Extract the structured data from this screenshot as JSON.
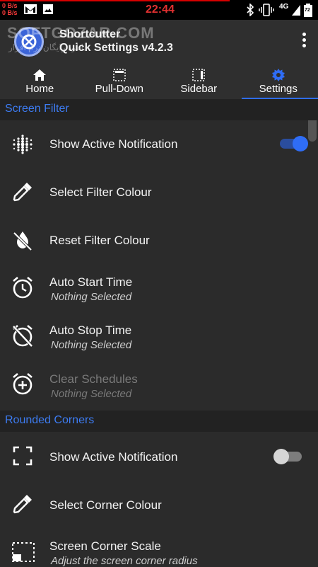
{
  "status_bar": {
    "net_up": "0 B/s",
    "net_down": "0 B/s",
    "time": "22:44",
    "network_label": "4G",
    "battery_level": "72",
    "icons": [
      "mail-icon",
      "image-icon",
      "bluetooth-icon",
      "vibrate-icon",
      "signal-icon",
      "battery-icon"
    ]
  },
  "app_bar": {
    "title_line1": "Shortcutter",
    "title_line2": "Quick Settings v4.2.3",
    "watermark": "SOFTGOZAR.COM",
    "watermark_sub": "دانلود رایگان نرم افزار",
    "menu_icon": "more-vert-icon"
  },
  "tabs": [
    {
      "label": "Home",
      "icon": "home-icon",
      "active": false
    },
    {
      "label": "Pull-Down",
      "icon": "pulldown-grid-icon",
      "active": false
    },
    {
      "label": "Sidebar",
      "icon": "sidebar-grid-icon",
      "active": false
    },
    {
      "label": "Settings",
      "icon": "gear-icon",
      "active": true
    }
  ],
  "sections": {
    "screen_filter": {
      "header": "Screen Filter",
      "rows": [
        {
          "title": "Show Active Notification",
          "subtitle": "",
          "icon": "dots-grid-icon",
          "toggle": "on"
        },
        {
          "title": "Select Filter Colour",
          "subtitle": "",
          "icon": "eyedropper-icon"
        },
        {
          "title": "Reset Filter Colour",
          "subtitle": "",
          "icon": "invert-colors-off-icon"
        },
        {
          "title": "Auto Start Time",
          "subtitle": "Nothing Selected",
          "icon": "alarm-icon"
        },
        {
          "title": "Auto Stop Time",
          "subtitle": "Nothing Selected",
          "icon": "alarm-off-icon"
        },
        {
          "title": "Clear Schedules",
          "subtitle": "Nothing Selected",
          "icon": "alarm-add-icon",
          "disabled": true
        }
      ]
    },
    "rounded_corners": {
      "header": "Rounded Corners",
      "rows": [
        {
          "title": "Show Active Notification",
          "subtitle": "",
          "icon": "fullscreen-corners-icon",
          "toggle": "off"
        },
        {
          "title": "Select Corner Colour",
          "subtitle": "",
          "icon": "eyedropper-icon"
        },
        {
          "title": "Screen Corner Scale",
          "subtitle": "Adjust the screen corner radius",
          "icon": "corner-scale-icon"
        }
      ]
    }
  },
  "colors": {
    "accent": "#2f6df6",
    "section_header_text": "#3d7cf2",
    "background": "#2b2b2b",
    "clock": "#e03030"
  }
}
